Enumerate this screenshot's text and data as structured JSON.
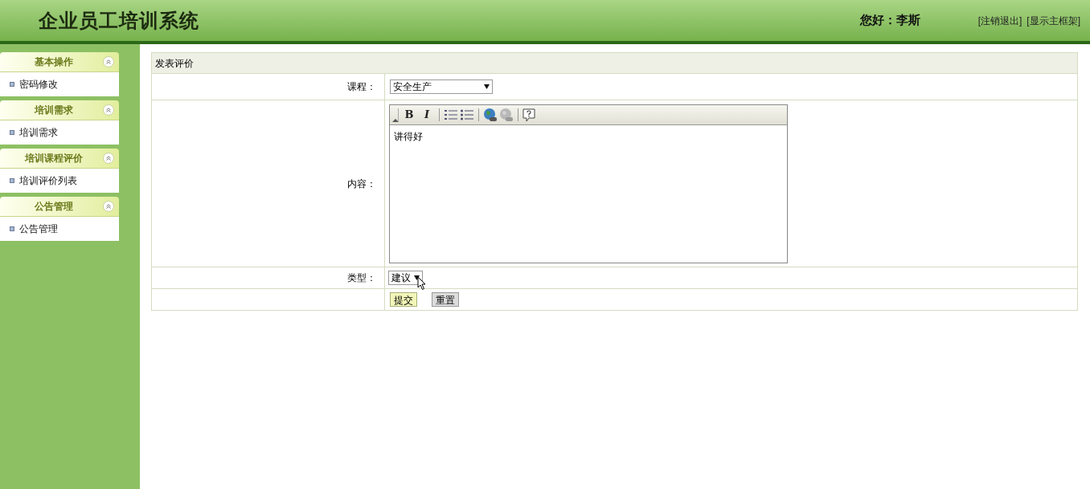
{
  "header": {
    "title": "企业员工培训系统",
    "greeting": "您好：李斯",
    "links": [
      "[注销退出]",
      "[显示主框架]"
    ]
  },
  "sidebar": [
    {
      "title": "基本操作",
      "expanded": true,
      "items": [
        "密码修改"
      ]
    },
    {
      "title": "培训需求",
      "expanded": true,
      "items": [
        "培训需求"
      ]
    },
    {
      "title": "培训课程评价",
      "expanded": true,
      "items": [
        "培训评价列表"
      ]
    },
    {
      "title": "公告管理",
      "expanded": true,
      "items": [
        "公告管理"
      ]
    }
  ],
  "form": {
    "title": "发表评价",
    "course": {
      "label": "课程：",
      "value": "安全生产"
    },
    "content": {
      "label": "内容：",
      "value": "讲得好",
      "toolbar": [
        {
          "kind": "bold",
          "label": "B"
        },
        {
          "kind": "italic",
          "label": "I"
        },
        {
          "kind": "separator"
        },
        {
          "kind": "ordered-list"
        },
        {
          "kind": "bullet-list"
        },
        {
          "kind": "separator"
        },
        {
          "kind": "link"
        },
        {
          "kind": "unlink"
        },
        {
          "kind": "separator"
        },
        {
          "kind": "help"
        }
      ]
    },
    "type": {
      "label": "类型：",
      "value": "建议"
    },
    "buttons": [
      {
        "label": "提交",
        "kind": "primary"
      },
      {
        "label": "重置",
        "kind": "secondary"
      }
    ]
  }
}
